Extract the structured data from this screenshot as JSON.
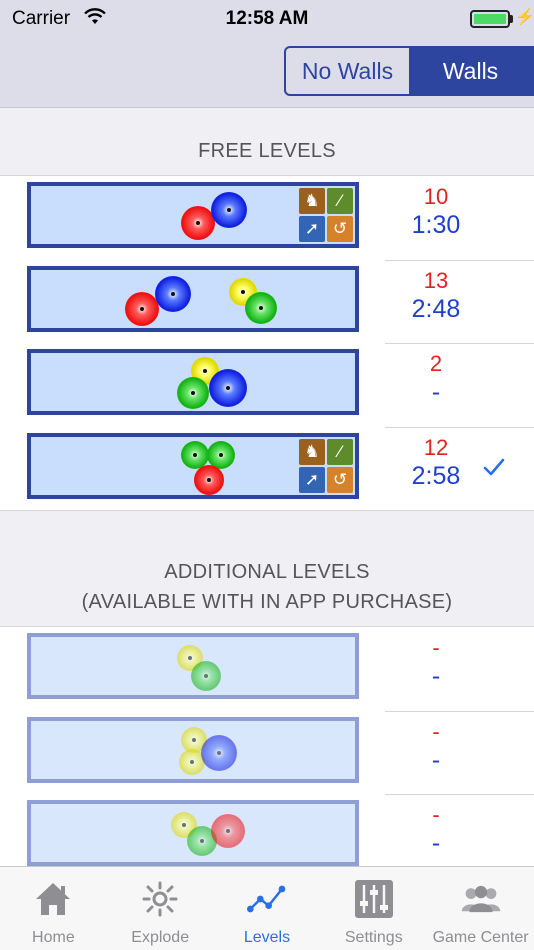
{
  "status": {
    "carrier": "Carrier",
    "time": "12:58 AM"
  },
  "segment": {
    "options": [
      "No Walls",
      "Walls"
    ],
    "selected": "Walls"
  },
  "free": {
    "header": "FREE LEVELS",
    "rows": [
      {
        "score": "10",
        "time": "1:30",
        "completed": false,
        "powerups": true
      },
      {
        "score": "13",
        "time": "2:48",
        "completed": false,
        "powerups": false
      },
      {
        "score": "2",
        "time": "-",
        "completed": false,
        "powerups": false
      },
      {
        "score": "12",
        "time": "2:58",
        "completed": true,
        "powerups": true
      }
    ]
  },
  "additional": {
    "header_line1": "ADDITIONAL LEVELS",
    "header_line2": "(AVAILABLE WITH IN APP PURCHASE)",
    "rows": [
      {
        "score": "-",
        "time": "-"
      },
      {
        "score": "-",
        "time": "-"
      },
      {
        "score": "-",
        "time": "-"
      }
    ]
  },
  "tabs": [
    {
      "label": "Home",
      "icon": "home-icon"
    },
    {
      "label": "Explode",
      "icon": "explode-icon"
    },
    {
      "label": "Levels",
      "icon": "levels-icon",
      "active": true
    },
    {
      "label": "Settings",
      "icon": "settings-icon"
    },
    {
      "label": "Game Center",
      "icon": "game-center-icon"
    }
  ],
  "colors": {
    "accent": "#2e45a0",
    "score": "#e52020",
    "time": "#1f3fcc",
    "tab_active": "#2a6fe6"
  }
}
